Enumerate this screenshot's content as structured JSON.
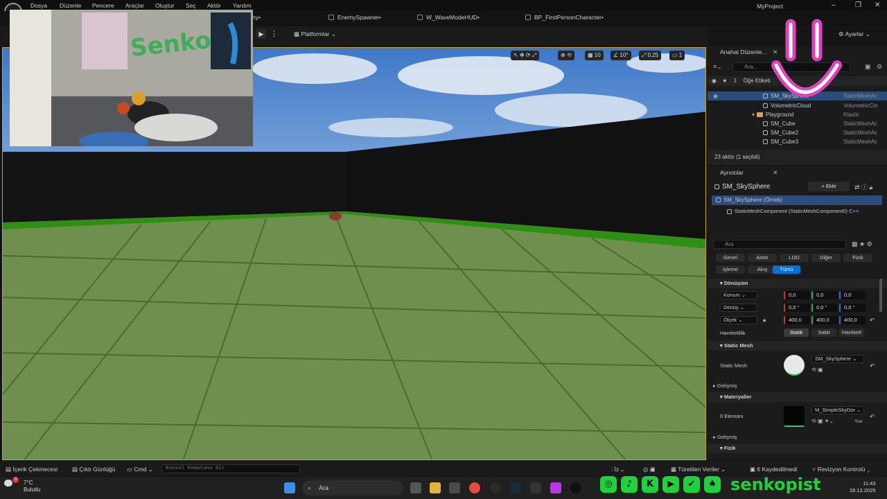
{
  "menu": [
    "Dosya",
    "Düzenle",
    "Pencere",
    "Araçlar",
    "Oluştur",
    "Seç",
    "Aktör",
    "Yardım"
  ],
  "project_name": "MyProject",
  "window_controls": [
    "–",
    "❐",
    "✕"
  ],
  "tabs": [
    "EnemySpawner•",
    "W_WaveModeHUD•",
    "BP_FirstPersonCharacter•"
  ],
  "tab_partial": "ny•",
  "toolbar": {
    "play": "▶",
    "more": "⋮",
    "platforms": "Platformlar",
    "settings": "Ayarlar"
  },
  "viewport": {
    "grid_snap": "10",
    "angle_snap": "10°",
    "scale_snap": "0,25",
    "camera_speed": "1"
  },
  "webcam": {
    "wall_text": "Senko"
  },
  "outliner": {
    "tab": "Anahat Düzenle...",
    "search_placeholder": "Ara...",
    "column_label": "Öğe Etiketi",
    "rows": [
      {
        "name": "SM_SkySphere",
        "type": "StaticMeshAc",
        "selected": true,
        "indent": 1
      },
      {
        "name": "VolumetricCloud",
        "type": "VolumetricClo",
        "indent": 1
      },
      {
        "name": "Playground",
        "type": "Klasör",
        "indent": 0,
        "folder": true
      },
      {
        "name": "SM_Cube",
        "type": "StaticMeshAc",
        "indent": 1
      },
      {
        "name": "SM_Cube2",
        "type": "StaticMeshAc",
        "indent": 1
      },
      {
        "name": "SM_Cube3",
        "type": "StaticMeshAc",
        "indent": 1
      }
    ],
    "count": "23 aktör (1 seçildi)"
  },
  "details": {
    "tab": "Ayrıntılar",
    "actor_name": "SM_SkySphere",
    "add_label": "+ Ekle",
    "instance": "SM_SkySphere (Örnek)",
    "component": "StaticMeshComponent (StaticMeshComponent0)",
    "component_suffix": "C++",
    "search_placeholder": "Ara",
    "filters_row1": [
      "Genel",
      "Aktör",
      "LOD",
      "Diğer",
      "Fizik"
    ],
    "filters_row2": [
      "İşleme",
      "Akış",
      "Tümü"
    ],
    "transform_section": "Dönüşüm",
    "location_label": "Konum",
    "location": [
      "0,0",
      "0,0",
      "0,0"
    ],
    "rotation_label": "Dönüş",
    "rotation": [
      "0,0 °",
      "0,0 °",
      "0,0 °"
    ],
    "scale_label": "Ölçek",
    "scale": [
      "400,0",
      "400,0",
      "400,0"
    ],
    "mobility_label": "Hareketlilik",
    "mobility": [
      "Statik",
      "Sabit",
      "Hareketl"
    ],
    "static_mesh_section": "Static Mesh",
    "static_mesh_label": "Static Mesh",
    "static_mesh_value": "SM_SkySphere",
    "advanced": "Gelişmiş",
    "materials_section": "Materyaller",
    "elements_label": "0 Elemanı",
    "material_value": "M_SimpleSkyDor",
    "material_suffix": "Yuv",
    "advanced2": "Gelişmiş",
    "physics_section": "Fizik"
  },
  "status": {
    "content_drawer": "İçerik Çekmecesi",
    "output_log": "Çıktı Günlüğü",
    "cmd": "Cmd",
    "console_placeholder": "Konsol Komutunu Gir",
    "derived": "Türetilen Veriler",
    "unsaved": "6 Kaydedilmedi",
    "revision": "Revizyon Kontrolü",
    "iz": "İz"
  },
  "taskbar": {
    "temp": "7°C",
    "weather": "Bulutlu",
    "search": "Ara",
    "time": "11:43",
    "date": "28.12.2025",
    "badge": "3"
  },
  "social_handle": "senkopist",
  "colors": {
    "accent": "#0a70d8",
    "social_green": "#1fd13c",
    "selection": "#2c4d7a",
    "viewport_border": "#c9a227"
  }
}
